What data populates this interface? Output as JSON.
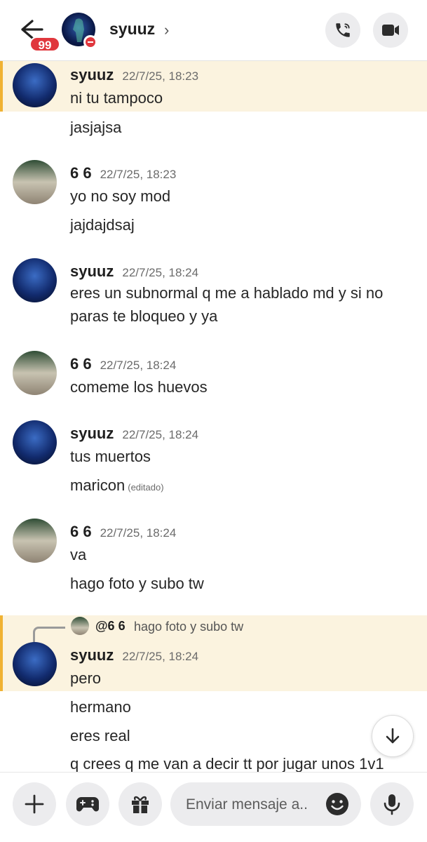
{
  "header": {
    "back_badge": "99",
    "title": "syuuz",
    "chevron": "›",
    "buttons": [
      "phone-icon",
      "video-icon"
    ]
  },
  "messages": [
    {
      "author": "syuuz",
      "timestamp": "22/7/25, 18:23",
      "lines": [
        "ni tu tampoco",
        "jasjajsa"
      ],
      "highlighted": true
    },
    {
      "author": "6 6",
      "timestamp": "22/7/25, 18:23",
      "lines": [
        "yo no soy mod",
        "jajdajdsaj"
      ]
    },
    {
      "author": "syuuz",
      "timestamp": "22/7/25, 18:24",
      "lines": [
        "eres un subnormal q me a hablado md y si no paras te bloqueo y ya"
      ]
    },
    {
      "author": "6 6",
      "timestamp": "22/7/25, 18:24",
      "lines": [
        "comeme los huevos"
      ]
    },
    {
      "author": "syuuz",
      "timestamp": "22/7/25, 18:24",
      "lines": [
        "tus muertos",
        "maricon"
      ],
      "edited_label": "(editado)"
    },
    {
      "author": "6 6",
      "timestamp": "22/7/25, 18:24",
      "lines": [
        "va",
        "hago foto y subo tw"
      ]
    },
    {
      "author": "syuuz",
      "timestamp": "22/7/25, 18:24",
      "lines": [
        "pero",
        "hermano",
        "eres real",
        "q crees q me van a decir tt por jugar unos 1v1"
      ],
      "highlighted": true,
      "reply": {
        "mention": "@6 6",
        "text": "hago foto y subo tw"
      }
    }
  ],
  "composer": {
    "placeholder": "Enviar mensaje a..",
    "buttons": [
      "plus-icon",
      "gamepad-icon",
      "gift-icon",
      "emoji-icon",
      "mic-icon"
    ]
  },
  "colors": {
    "highlight_bg": "#fbf3df",
    "highlight_bar": "#f0b232",
    "badge": "#e0373d"
  }
}
